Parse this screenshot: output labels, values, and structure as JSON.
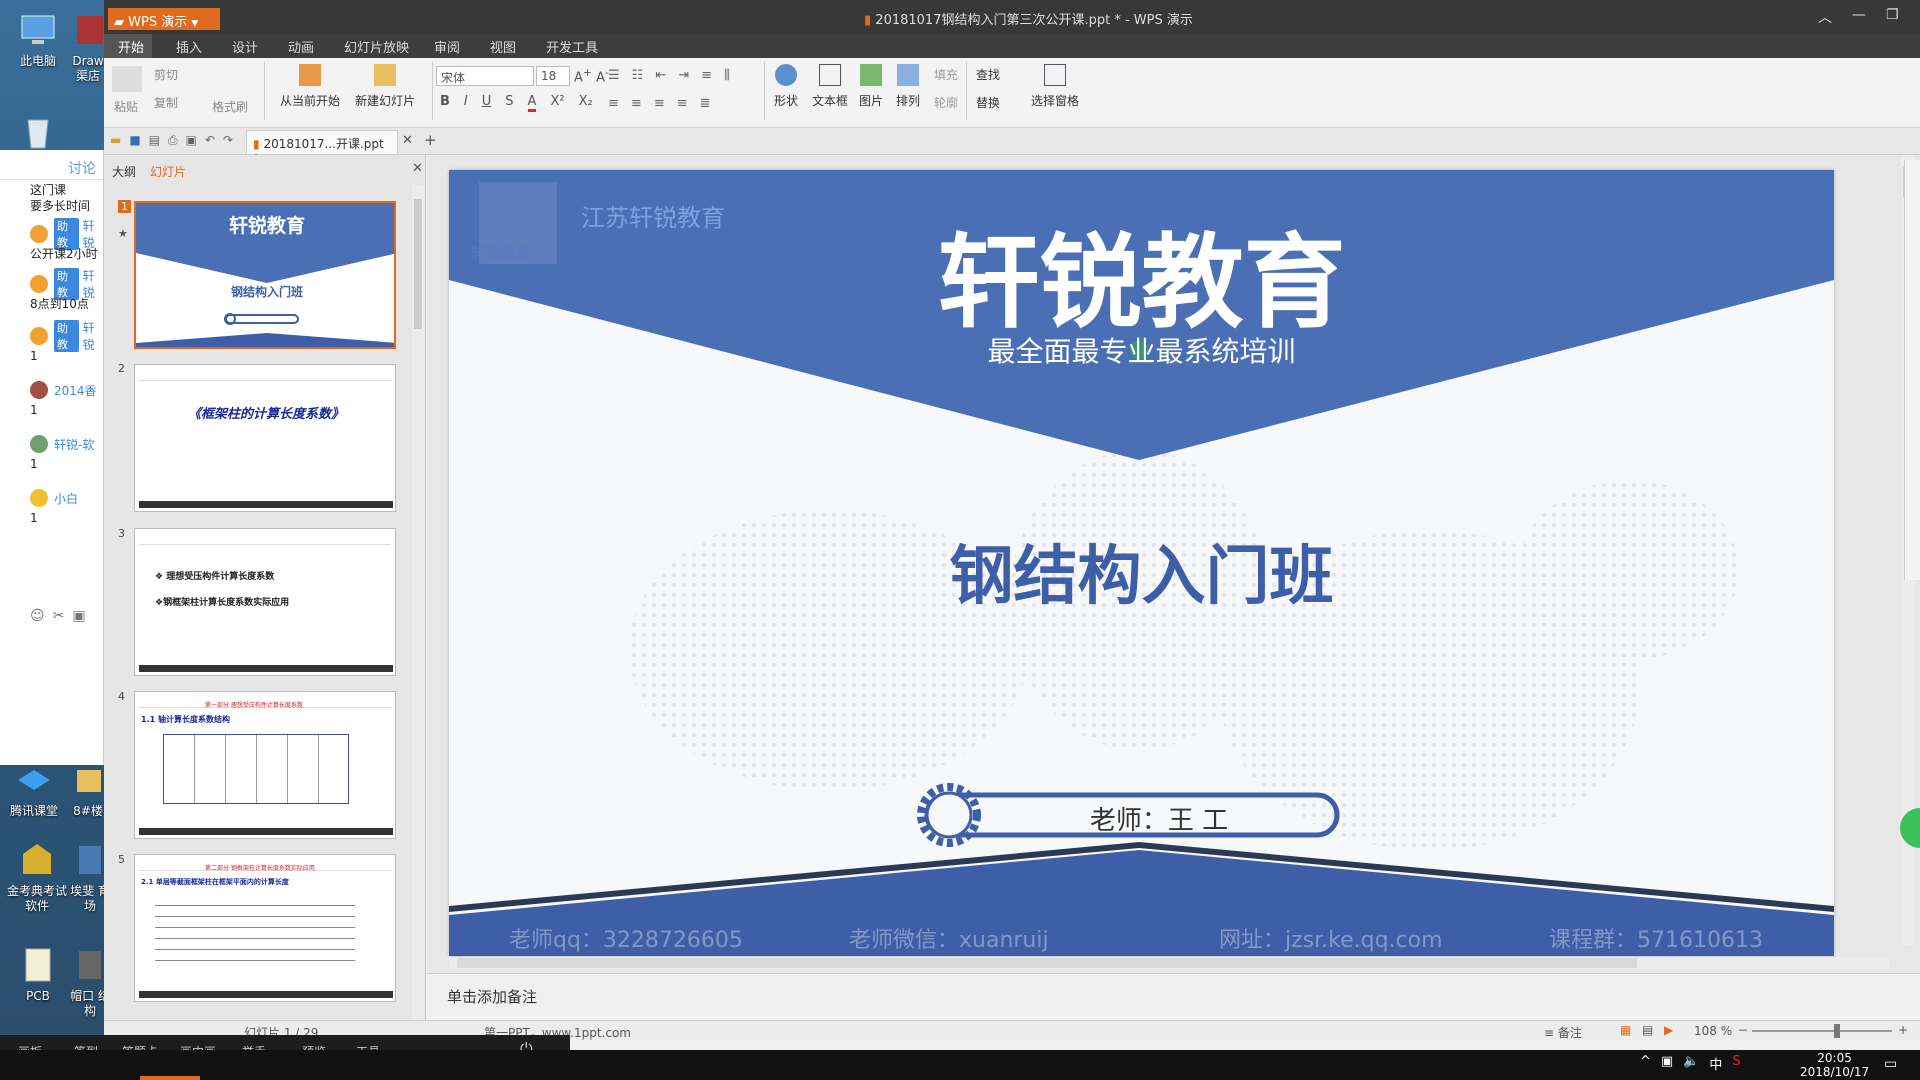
{
  "window": {
    "app_button": "WPS 演示",
    "title": "20181017钢结构入门第三次公开课.ppt * - WPS 演示"
  },
  "menu": [
    "开始",
    "插入",
    "设计",
    "动画",
    "幻灯片放映",
    "审阅",
    "视图",
    "开发工具"
  ],
  "ribbon": {
    "paste": "粘贴",
    "cut": "剪切",
    "copy": "复制",
    "format_painter": "格式刷",
    "from_current": "从当前开始",
    "new_slide": "新建幻灯片",
    "font_name": "宋体",
    "font_size": "18",
    "shape": "形状",
    "textbox": "文本框",
    "picture": "图片",
    "arrange": "排列",
    "fill": "填充",
    "outline": "轮廓",
    "find": "查找",
    "replace": "替换",
    "selection_pane": "选择窗格"
  },
  "doc_tab": "20181017...开课.ppt *",
  "left_pane": {
    "tab_outline": "大纲",
    "tab_slides": "幻灯片",
    "thumbs": [
      {
        "num": "1",
        "title": "轩锐教育",
        "subtitle": "钢结构入门班"
      },
      {
        "num": "2",
        "title": "《框架柱的计算长度系数》"
      },
      {
        "num": "3",
        "line1": "❖ 理想受压构件计算长度系数",
        "line2": "❖钢框架柱计算长度系数实际应用"
      },
      {
        "num": "4",
        "title": "第一部分 理想受压构件计算长度系数",
        "sub": "1.1 轴计算长度系数结构"
      },
      {
        "num": "5",
        "title": "第二部分 钢框架柱计算长度系数实际应用",
        "sub": "2.1 单层等截面框架柱在框架平面内的计算长度"
      }
    ]
  },
  "slide": {
    "org": "江苏轩锐教育",
    "logo_text": "轩锐教育",
    "title": "轩锐教育",
    "tagline": "最全面最专业最系统培训",
    "course": "钢结构入门班",
    "teacher": "老师：王 工",
    "footer": [
      "老师qq：3228726605",
      "老师微信：xuanruij",
      "网址：jzsr.ke.qq.com",
      "课程群：571610613"
    ]
  },
  "notes_placeholder": "单击添加备注",
  "status": {
    "slide_count": "幻灯片 1 / 29",
    "theme": "第一PPT，www.1ppt.com",
    "notes": "备注",
    "zoom": "108 %"
  },
  "chat": {
    "tab": "讨论",
    "messages": [
      {
        "text": "这门课\n要多长时间"
      },
      {
        "tag": "助教",
        "user": "轩锐",
        "text": "公开课2小时"
      },
      {
        "tag": "助教",
        "user": "轩锐",
        "text": "8点到10点"
      },
      {
        "tag": "助教",
        "user": "轩锐",
        "text": "1"
      },
      {
        "user": "2014香",
        "text": "1"
      },
      {
        "user": "轩锐-软",
        "text": "1"
      },
      {
        "user": "小白",
        "text": "1"
      }
    ]
  },
  "desktop_icons": [
    "此电脑",
    "Draw\n渠店",
    "腾讯课堂",
    "8#楼",
    "金考典考试软件",
    "埃斐\n育场",
    "PCB",
    "帽口\n结构"
  ],
  "class_toolbar": [
    "画板",
    "签到",
    "答题卡",
    "画中画",
    "举手",
    "预览",
    "工具"
  ],
  "taskbar": {
    "ime": "中",
    "time": "20:05",
    "date": "2018/10/17"
  },
  "colors": {
    "slide_blue": "#4a6fb5",
    "wps_orange": "#e06b1f",
    "title_dark": "#383838"
  }
}
